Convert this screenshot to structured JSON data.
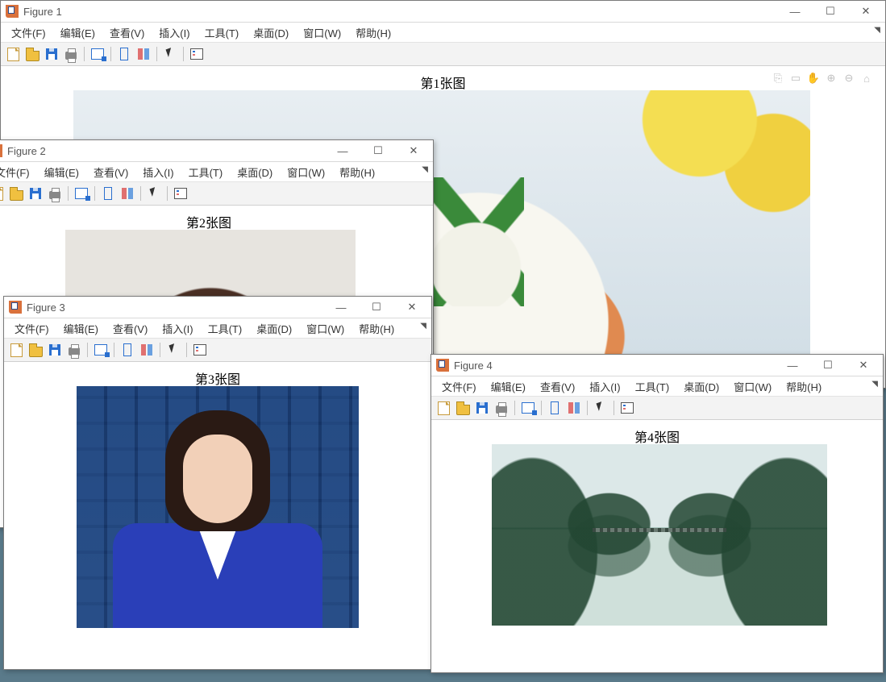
{
  "menus": {
    "file": "文件(F)",
    "edit": "编辑(E)",
    "view": "查看(V)",
    "insert": "插入(I)",
    "tools": "工具(T)",
    "desktop": "桌面(D)",
    "window": "窗口(W)",
    "help": "帮助(H)"
  },
  "figures": {
    "f1": {
      "title": "Figure 1",
      "plot_title": "第1张图"
    },
    "f2": {
      "title": "Figure 2",
      "plot_title": "第2张图"
    },
    "f3": {
      "title": "Figure 3",
      "plot_title": "第3张图"
    },
    "f4": {
      "title": "Figure 4",
      "plot_title": "第4张图"
    }
  },
  "win_btn_glyphs": {
    "min": "—",
    "max": "☐",
    "close": "✕"
  },
  "toolbar_buttons": [
    "new",
    "open",
    "save",
    "print",
    "|",
    "figpal",
    "|",
    "link",
    "insert",
    "|",
    "arrow",
    "|",
    "legend"
  ],
  "axes_tool_glyphs": [
    "⎘",
    "▭",
    "✋",
    "⊕",
    "⊖",
    "⌂"
  ]
}
